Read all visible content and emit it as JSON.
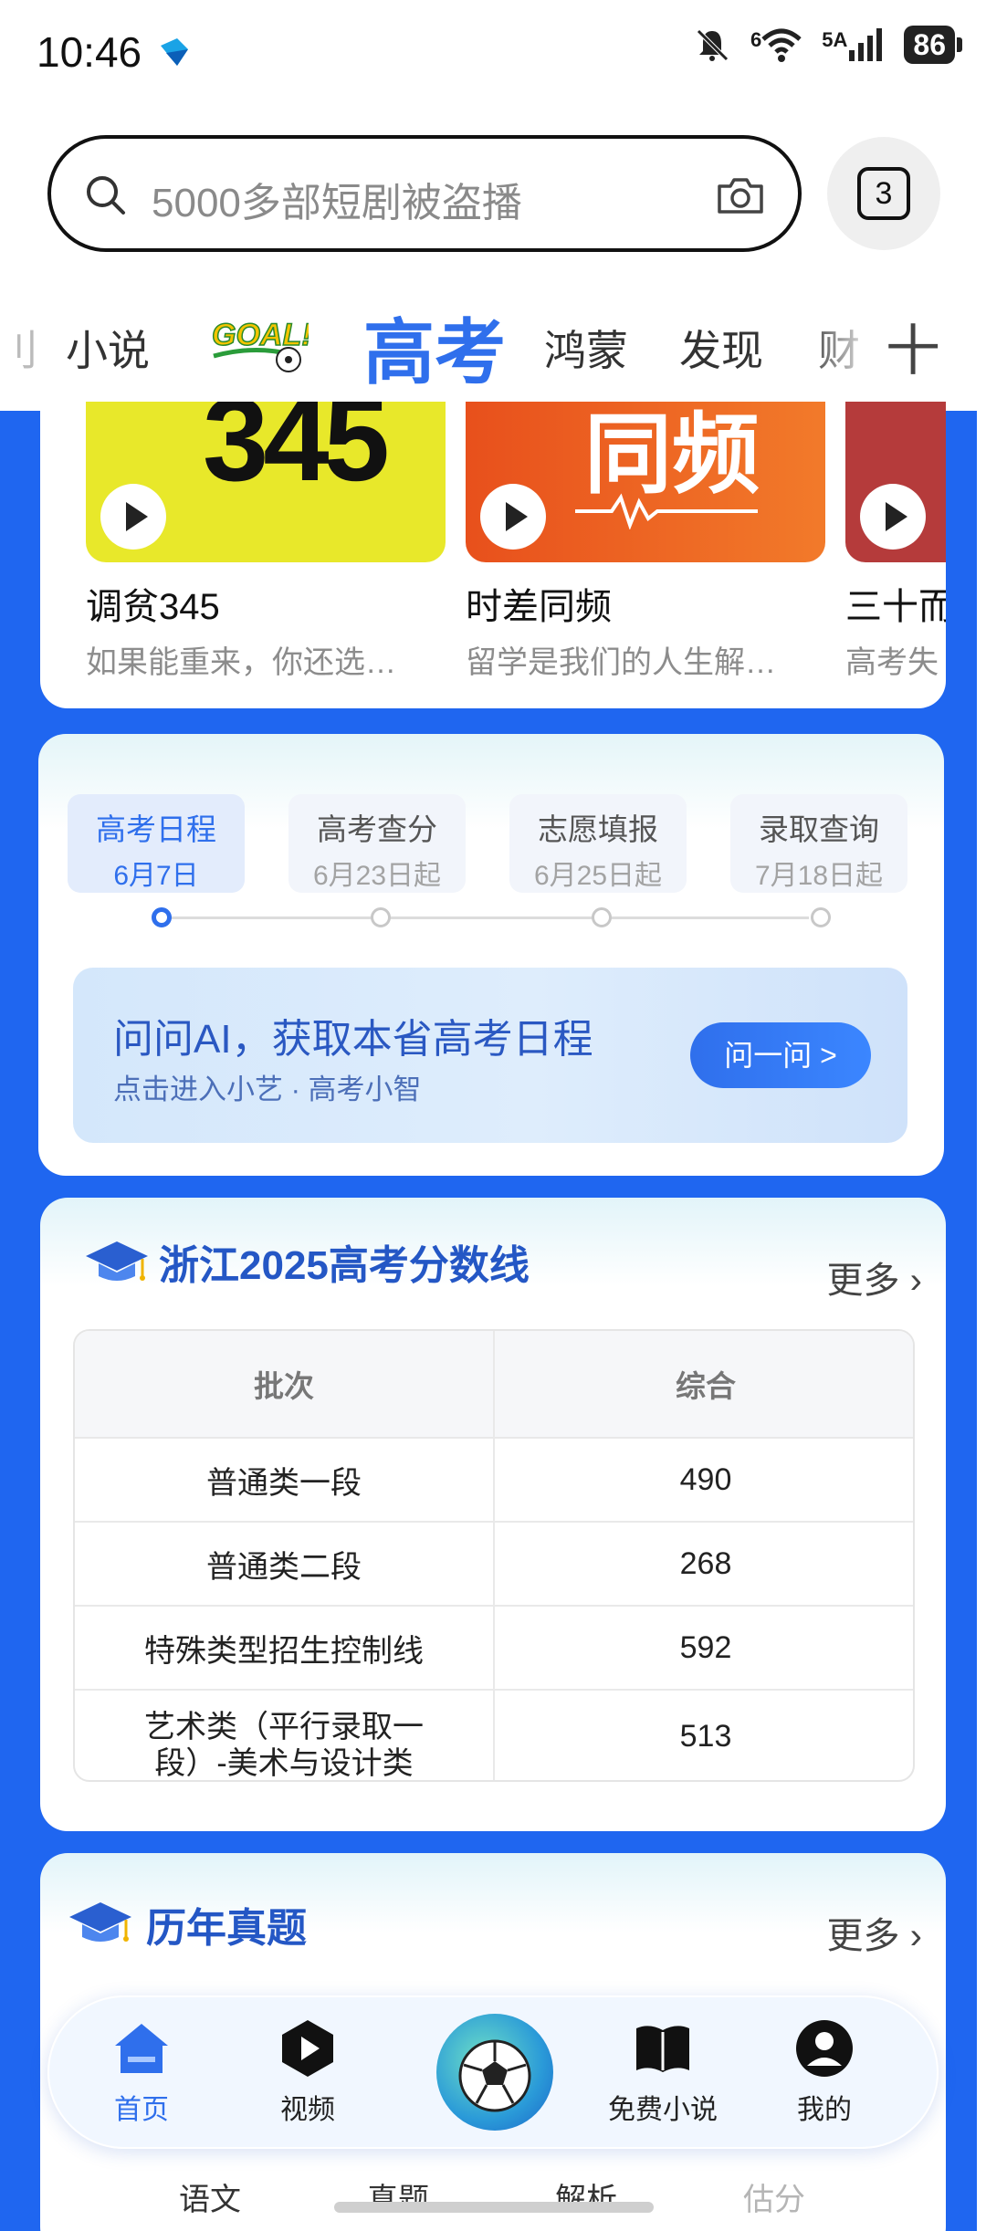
{
  "status_bar": {
    "time": "10:46",
    "network": "5A",
    "wifi_badge": "6",
    "battery": "86"
  },
  "search": {
    "placeholder": "5000多部短剧被盗播",
    "tab_count": "3"
  },
  "channels": {
    "items": [
      "小说",
      "高考",
      "鸿蒙",
      "发现",
      "财"
    ],
    "active": "高考",
    "add_label": "十",
    "event_badge": "GOAL!"
  },
  "shows": [
    {
      "title": "调贫345",
      "subtitle": "如果能重来，你还选…",
      "cover_text": "345",
      "color": "#e8e82a"
    },
    {
      "title": "时差同频",
      "subtitle": "留学是我们的人生解…",
      "cover_text": "同频",
      "color": "#f05a1e"
    },
    {
      "title": "三十而",
      "subtitle": "高考失",
      "color": "#b53b3b"
    }
  ],
  "schedule": {
    "steps": [
      {
        "name": "高考日程",
        "date": "6月7日"
      },
      {
        "name": "高考查分",
        "date": "6月23日起"
      },
      {
        "name": "志愿填报",
        "date": "6月25日起"
      },
      {
        "name": "录取查询",
        "date": "7月18日起"
      }
    ],
    "ai_banner": {
      "title": "问问AI，获取本省高考日程",
      "subtitle": "点击进入小艺 · 高考小智",
      "button": "问一问 >"
    }
  },
  "score_card": {
    "title": "浙江2025高考分数线",
    "more": "更多",
    "headers": [
      "批次",
      "综合"
    ],
    "rows": [
      {
        "batch": "普通类一段",
        "score": "490"
      },
      {
        "batch": "普通类二段",
        "score": "268"
      },
      {
        "batch": "特殊类型招生控制线",
        "score": "592"
      },
      {
        "batch": "艺术类（平行录取一段）-美术与设计类",
        "score": "513"
      }
    ]
  },
  "exams_card": {
    "title": "历年真题",
    "more": "更多",
    "tabs": [
      "语文",
      "真题",
      "解析",
      "估分"
    ]
  },
  "bottom_nav": {
    "items": [
      "首页",
      "视频",
      "免费小说",
      "我的"
    ],
    "active": "首页"
  },
  "colors": {
    "brand_blue": "#2f6fec",
    "background_blue": "#1f66f0"
  }
}
